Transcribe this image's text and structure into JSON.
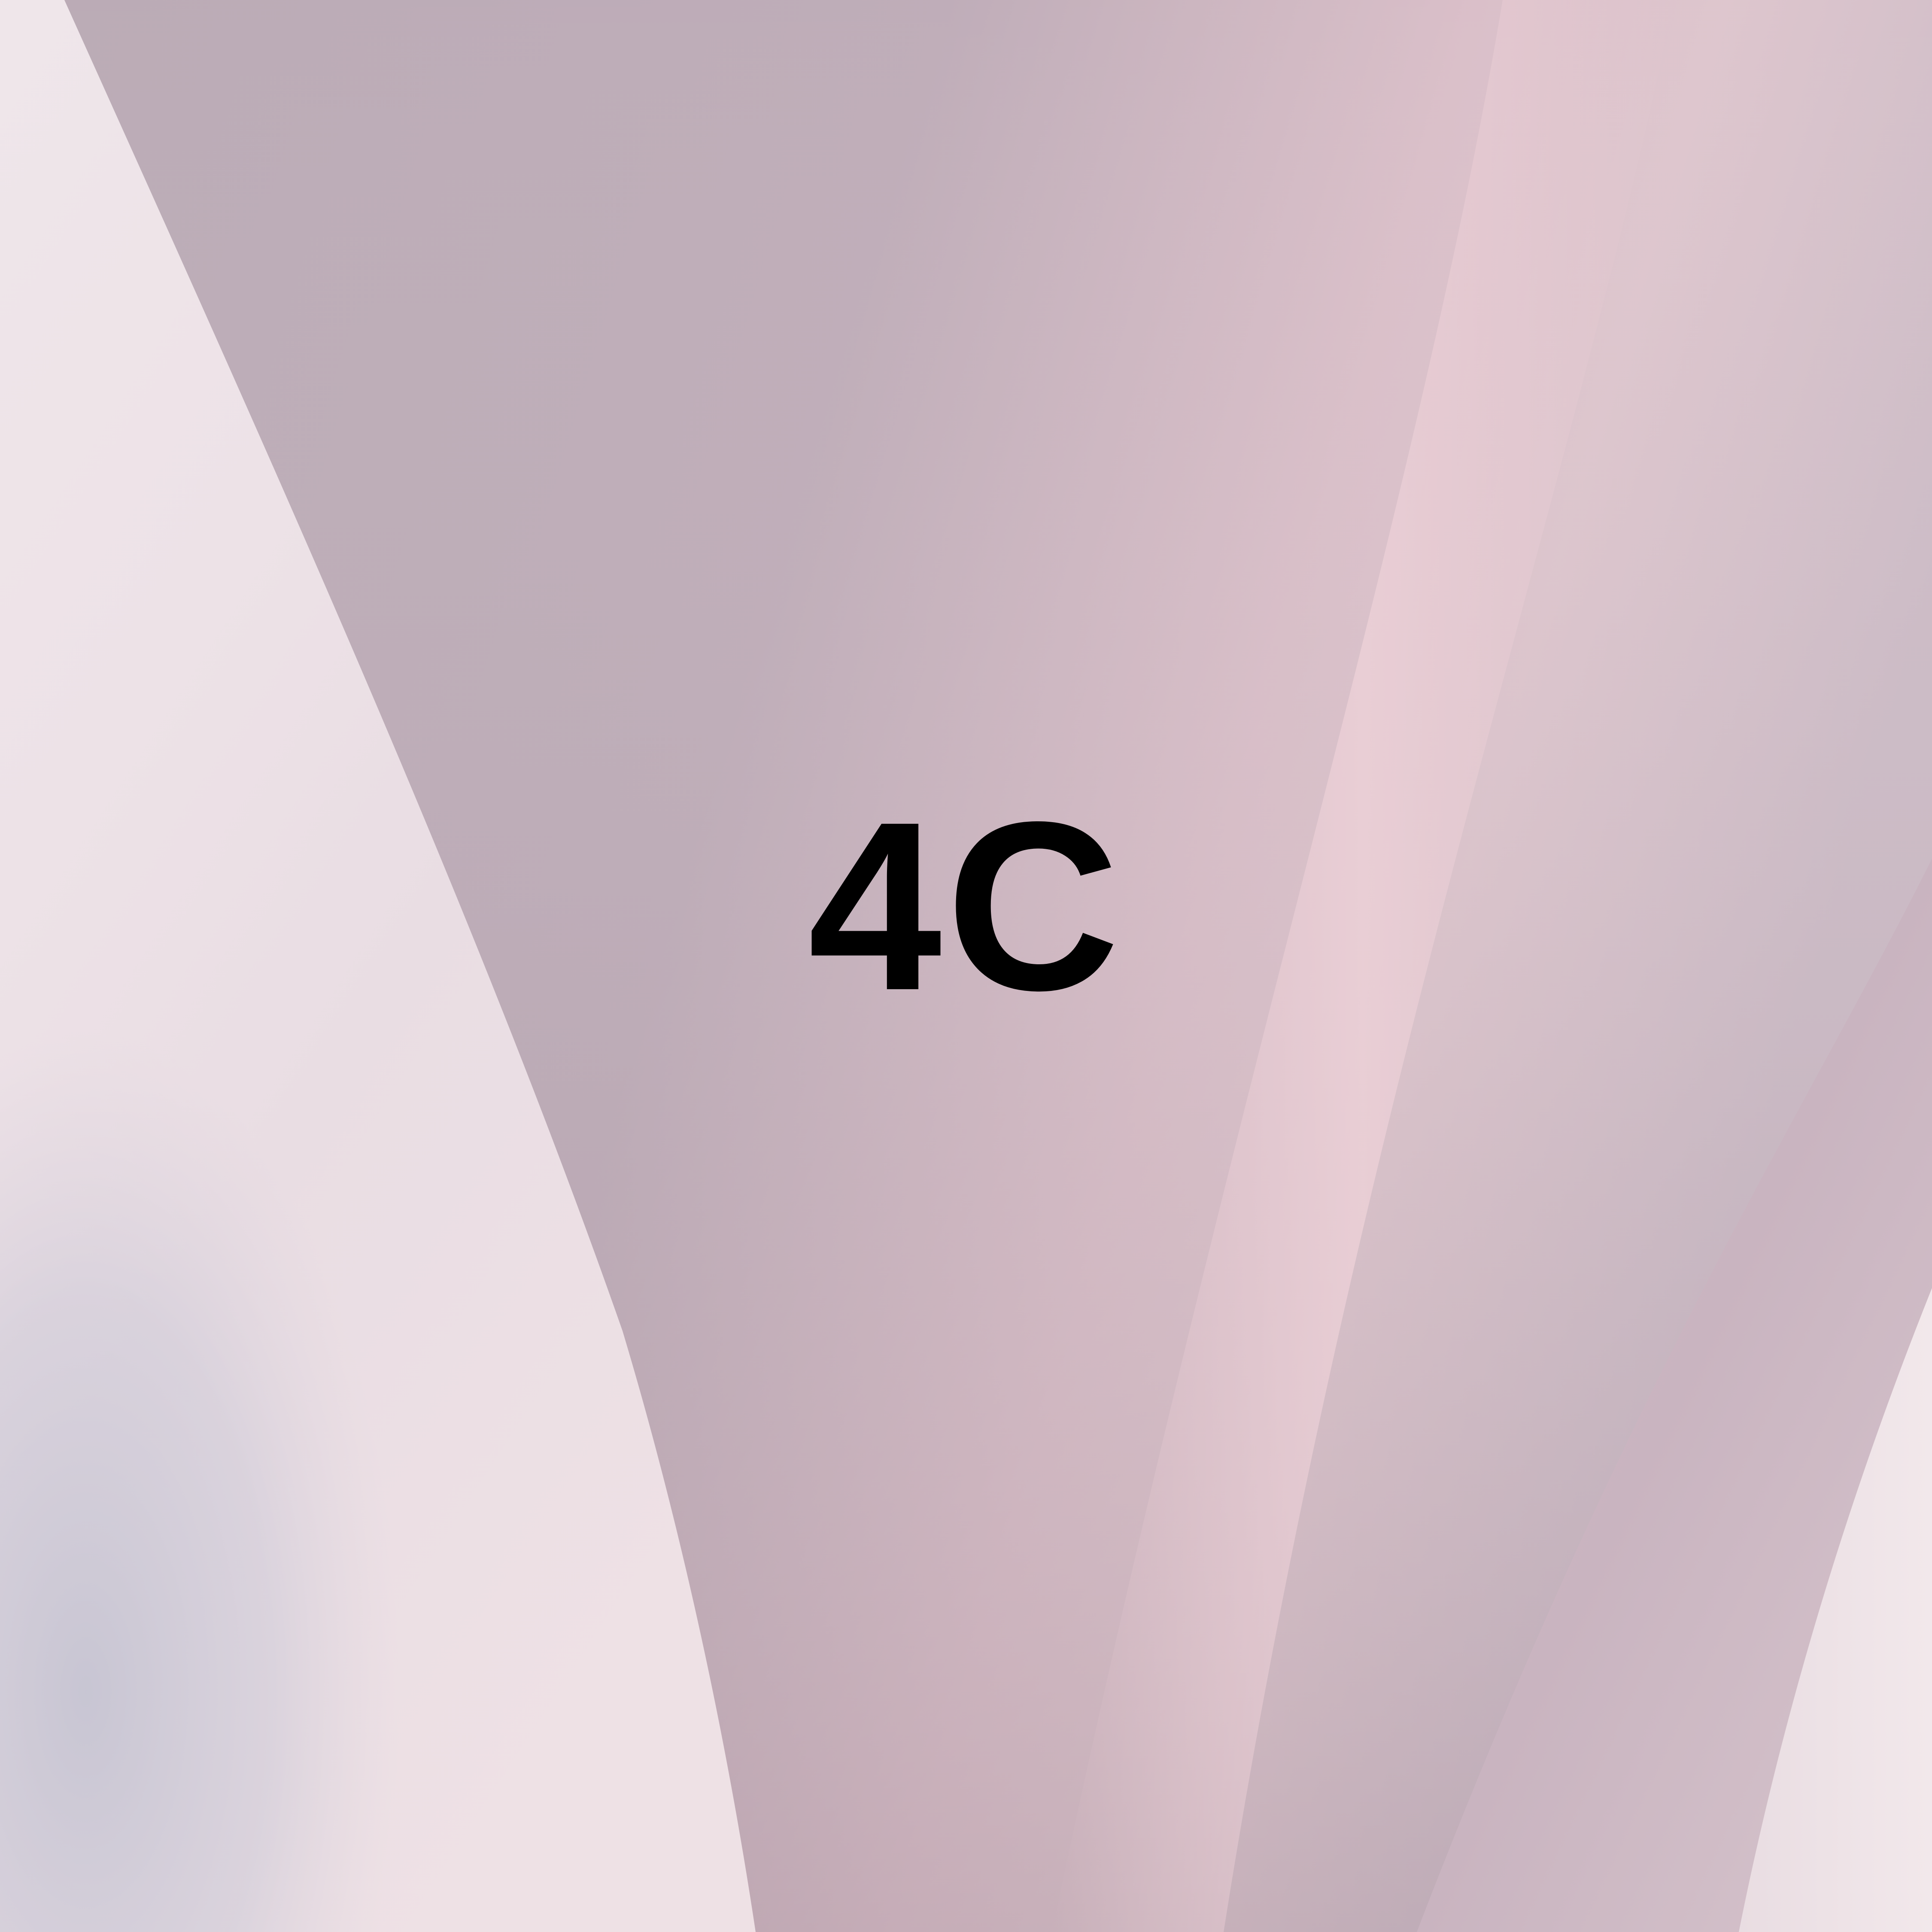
{
  "label": {
    "text": "4C",
    "color": "#000000"
  },
  "background": {
    "palette": {
      "center_mauve": "#b3a1ac",
      "center_top": "#bcabb7",
      "pink_streak": "#e6c9d1",
      "left_panel_light": "#eee3e8",
      "left_panel_shadow": "#cbc8d5",
      "right_panel": "#cdb8c3",
      "right_edge_light": "#f1e6e9"
    }
  }
}
